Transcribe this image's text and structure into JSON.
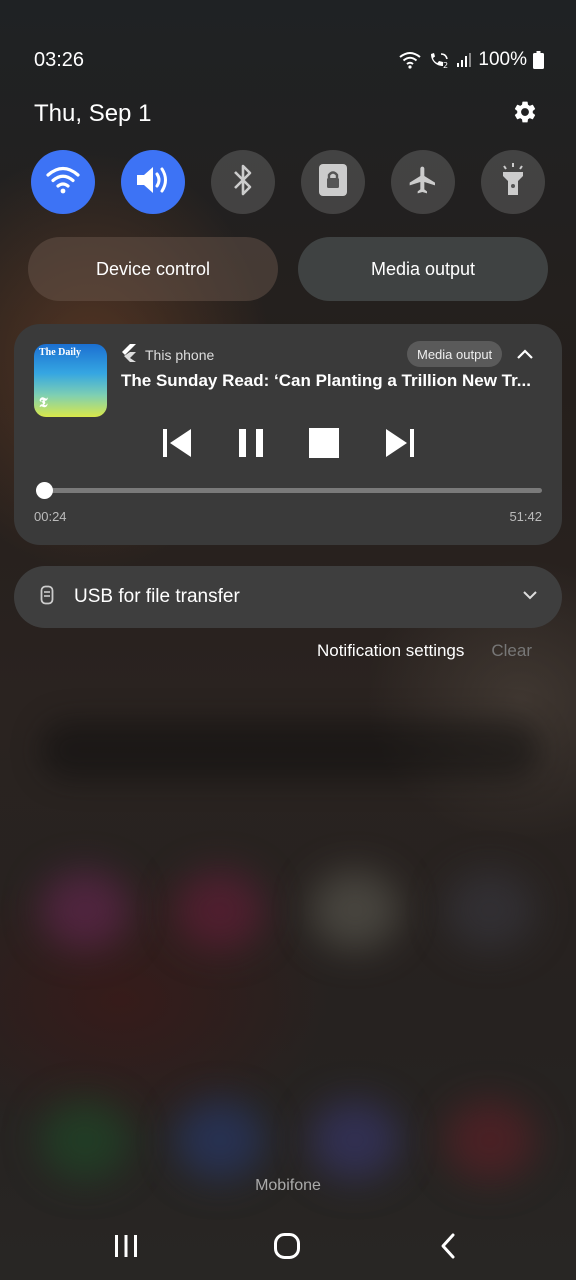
{
  "status_bar": {
    "time": "03:26",
    "battery": "100%"
  },
  "header": {
    "date": "Thu, Sep 1"
  },
  "quick_settings": [
    {
      "icon": "wifi-icon",
      "active": true
    },
    {
      "icon": "sound-icon",
      "active": true
    },
    {
      "icon": "bluetooth-icon",
      "active": false
    },
    {
      "icon": "lock-screen-icon",
      "active": false
    },
    {
      "icon": "airplane-icon",
      "active": false
    },
    {
      "icon": "flashlight-icon",
      "active": false
    }
  ],
  "pills": {
    "device_control": "Device control",
    "media_output": "Media output"
  },
  "media": {
    "artwork_title": "The Daily",
    "artwork_mark": "𝕿",
    "source": "This phone",
    "output_button": "Media output",
    "track": "The Sunday Read: ‘Can Planting a Trillion New Tr...",
    "elapsed": "00:24",
    "duration": "51:42",
    "progress": 0.008
  },
  "usb": {
    "label": "USB for file transfer"
  },
  "notification_actions": {
    "settings": "Notification settings",
    "clear": "Clear"
  },
  "carrier": "Mobifone",
  "colors": {
    "accent": "#3d73f5",
    "panel": "#3a3a3a"
  }
}
